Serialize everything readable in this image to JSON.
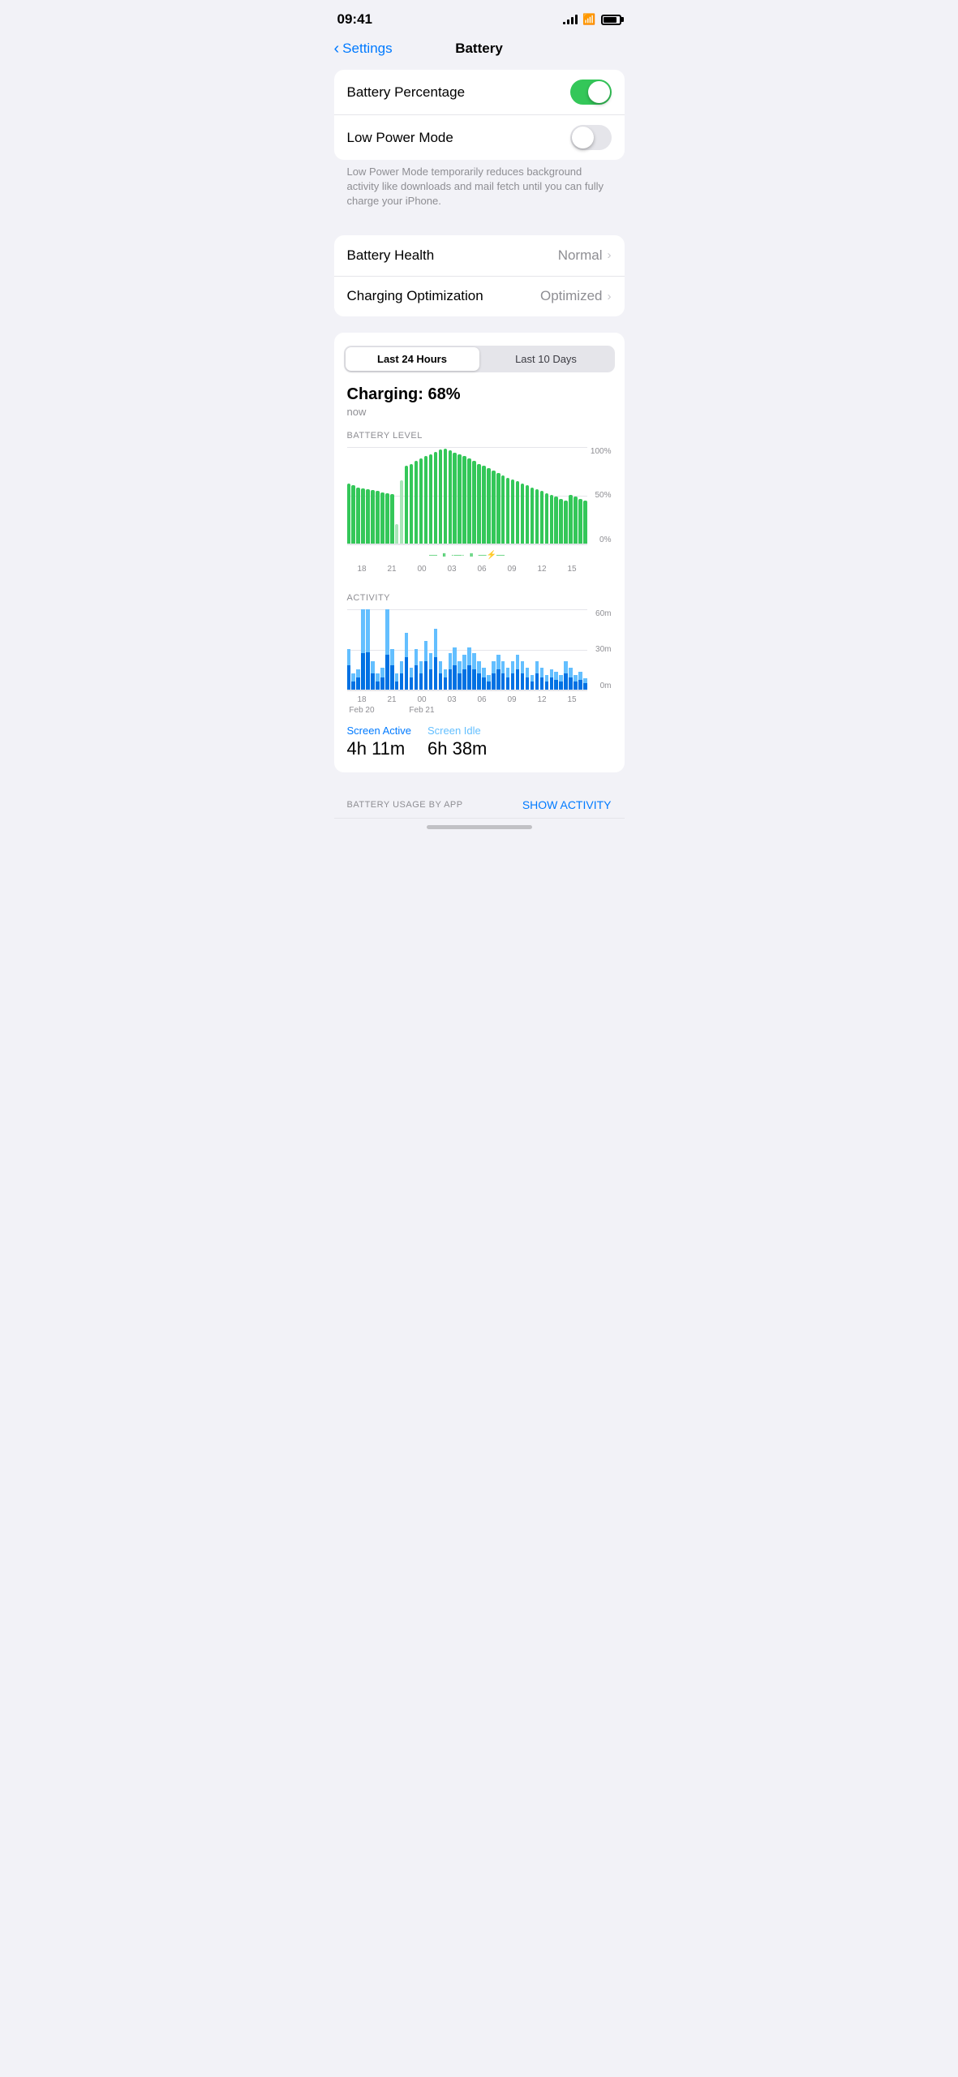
{
  "statusBar": {
    "time": "09:41",
    "batteryLevel": 85
  },
  "nav": {
    "backLabel": "Settings",
    "title": "Battery"
  },
  "settings": {
    "batteryPercentage": {
      "label": "Battery Percentage",
      "enabled": true
    },
    "lowPowerMode": {
      "label": "Low Power Mode",
      "enabled": false,
      "description": "Low Power Mode temporarily reduces background activity like downloads and mail fetch until you can fully charge your iPhone."
    },
    "batteryHealth": {
      "label": "Battery Health",
      "value": "Normal"
    },
    "chargingOptimization": {
      "label": "Charging Optimization",
      "value": "Optimized"
    }
  },
  "usagePanel": {
    "segmentLabels": [
      "Last 24 Hours",
      "Last 10 Days"
    ],
    "activeSegment": 0,
    "chargingPct": "Charging: 68%",
    "chargingTime": "now",
    "batteryLevelLabel": "BATTERY LEVEL",
    "activityLabel": "ACTIVITY",
    "yLabels100": "100%",
    "yLabels50": "50%",
    "yLabels0": "0%",
    "activityY60": "60m",
    "activityY30": "30m",
    "activityY0": "0m",
    "xAxisLabels": [
      "18",
      "21",
      "00",
      "03",
      "06",
      "09",
      "12",
      "15"
    ],
    "dateLabels": [
      "Feb 20",
      "",
      "Feb 21",
      "",
      "",
      "",
      "",
      ""
    ],
    "screenActive": {
      "label": "Screen Active",
      "value": "4h 11m"
    },
    "screenIdle": {
      "label": "Screen Idle",
      "value": "6h 38m"
    },
    "batteryUsageByApp": "BATTERY USAGE BY APP",
    "showActivity": "SHOW ACTIVITY"
  }
}
